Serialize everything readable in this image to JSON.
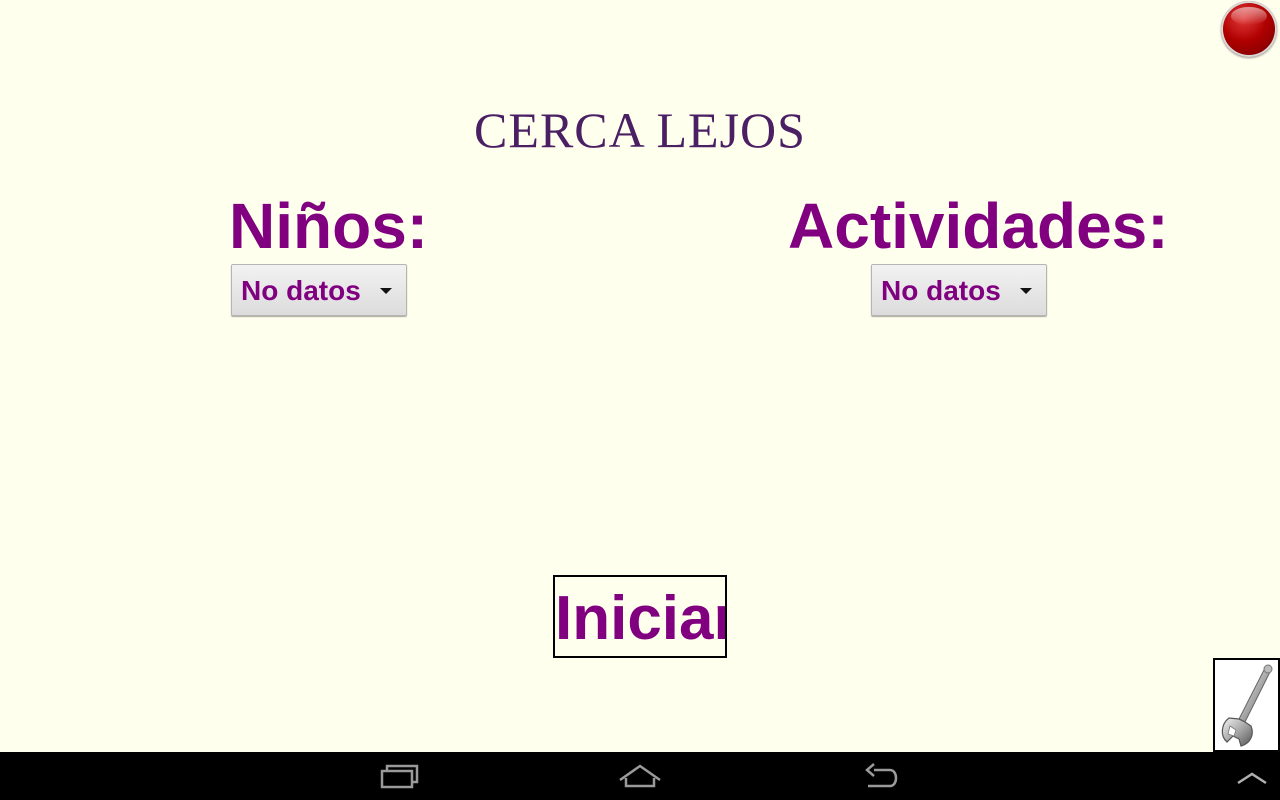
{
  "app": {
    "title": "CERCA LEJOS"
  },
  "children": {
    "label": "Niños:",
    "selected": "No datos"
  },
  "activities": {
    "label": "Actividades:",
    "selected": "No datos"
  },
  "start_button": {
    "label": "Iniciar"
  },
  "icons": {
    "record": "record-icon",
    "settings": "wrench-icon",
    "recents": "recent-apps-icon",
    "home": "home-icon",
    "back": "back-icon",
    "up": "chevron-up-icon"
  },
  "colors": {
    "background": "#FFFFEE",
    "title": "#4A1F63",
    "accent": "#800080",
    "navbar": "#000000"
  }
}
